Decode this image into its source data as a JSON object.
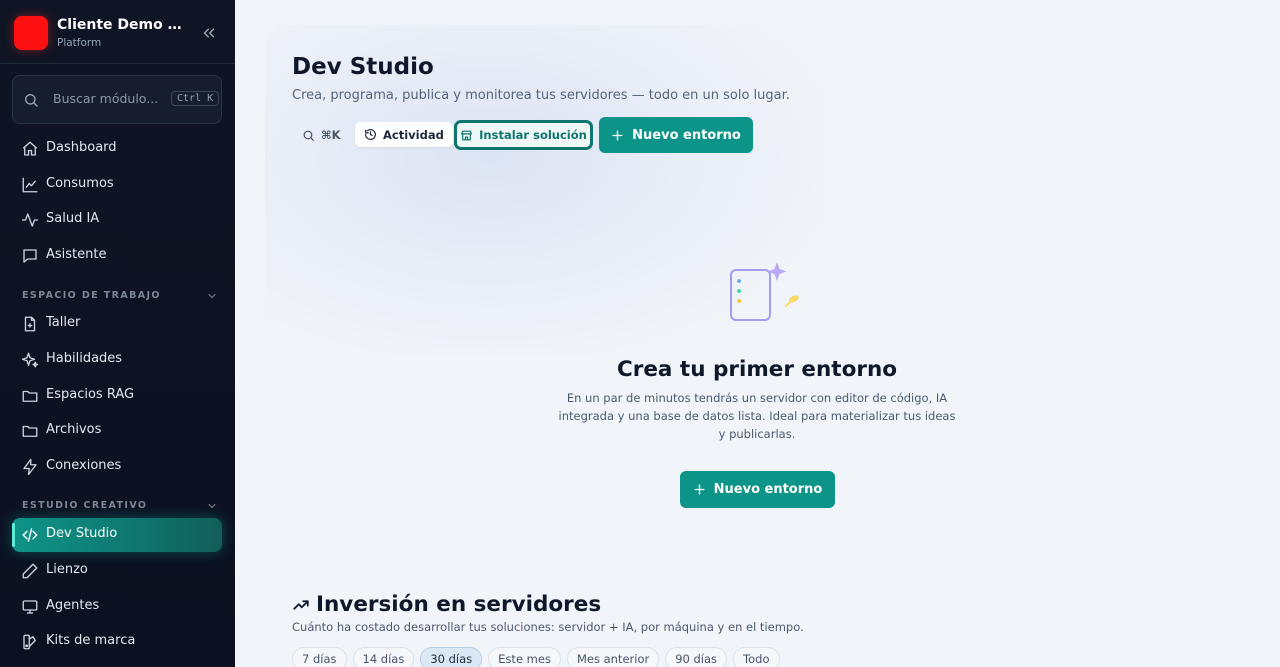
{
  "brand": {
    "name": "Cliente Demo Sl...",
    "subtitle": "Platform",
    "logo_color": "#ff1010"
  },
  "sidebar": {
    "search": {
      "placeholder": "Buscar módulo...",
      "shortcut": "Ctrl K"
    },
    "top_items": [
      {
        "label": "Dashboard",
        "icon": "home-icon"
      },
      {
        "label": "Consumos",
        "icon": "line-chart-icon"
      },
      {
        "label": "Salud IA",
        "icon": "activity-icon"
      },
      {
        "label": "Asistente",
        "icon": "chat-icon"
      }
    ],
    "workspace": {
      "title": "ESPACIO DE TRABAJO",
      "items": [
        {
          "label": "Taller",
          "icon": "file-plus-icon"
        },
        {
          "label": "Habilidades",
          "icon": "sparkles-icon"
        },
        {
          "label": "Espacios RAG",
          "icon": "folder-icon"
        },
        {
          "label": "Archivos",
          "icon": "folder-icon"
        },
        {
          "label": "Conexiones",
          "icon": "zap-icon"
        }
      ]
    },
    "creative": {
      "title": "ESTUDIO CREATIVO",
      "items": [
        {
          "label": "Dev Studio",
          "icon": "code-icon",
          "active": true
        },
        {
          "label": "Lienzo",
          "icon": "pencil-icon"
        },
        {
          "label": "Agentes",
          "icon": "monitor-icon"
        },
        {
          "label": "Kits de marca",
          "icon": "palette-icon"
        }
      ]
    }
  },
  "main": {
    "title": "Dev Studio",
    "subtitle": "Crea, programa, publica y monitorea tus servidores — todo en un solo lugar.",
    "toolbar": {
      "command_label": "⌘K",
      "activity_label": "Actividad",
      "install_label": "Instalar solución",
      "new_env_label": "Nuevo entorno"
    },
    "empty_state": {
      "title": "Crea tu primer entorno",
      "description": "En un par de minutos tendrás un servidor con editor de código, IA integrada y una base de datos lista. Ideal para materializar tus ideas y publicarlas.",
      "button_label": "Nuevo entorno"
    },
    "investment": {
      "title": "Inversión en servidores",
      "subtitle": "Cuánto ha costado desarrollar tus soluciones: servidor + IA, por máquina y en el tiempo.",
      "ranges": [
        {
          "label": "7 días",
          "active": false
        },
        {
          "label": "14 días",
          "active": false
        },
        {
          "label": "30 días",
          "active": true
        },
        {
          "label": "Este mes",
          "active": false
        },
        {
          "label": "Mes anterior",
          "active": false
        },
        {
          "label": "90 días",
          "active": false
        },
        {
          "label": "Todo",
          "active": false
        }
      ]
    }
  },
  "colors": {
    "accent": "#0d9488",
    "accent_dark": "#0f766e",
    "sidebar_bg": "#0f1524"
  }
}
